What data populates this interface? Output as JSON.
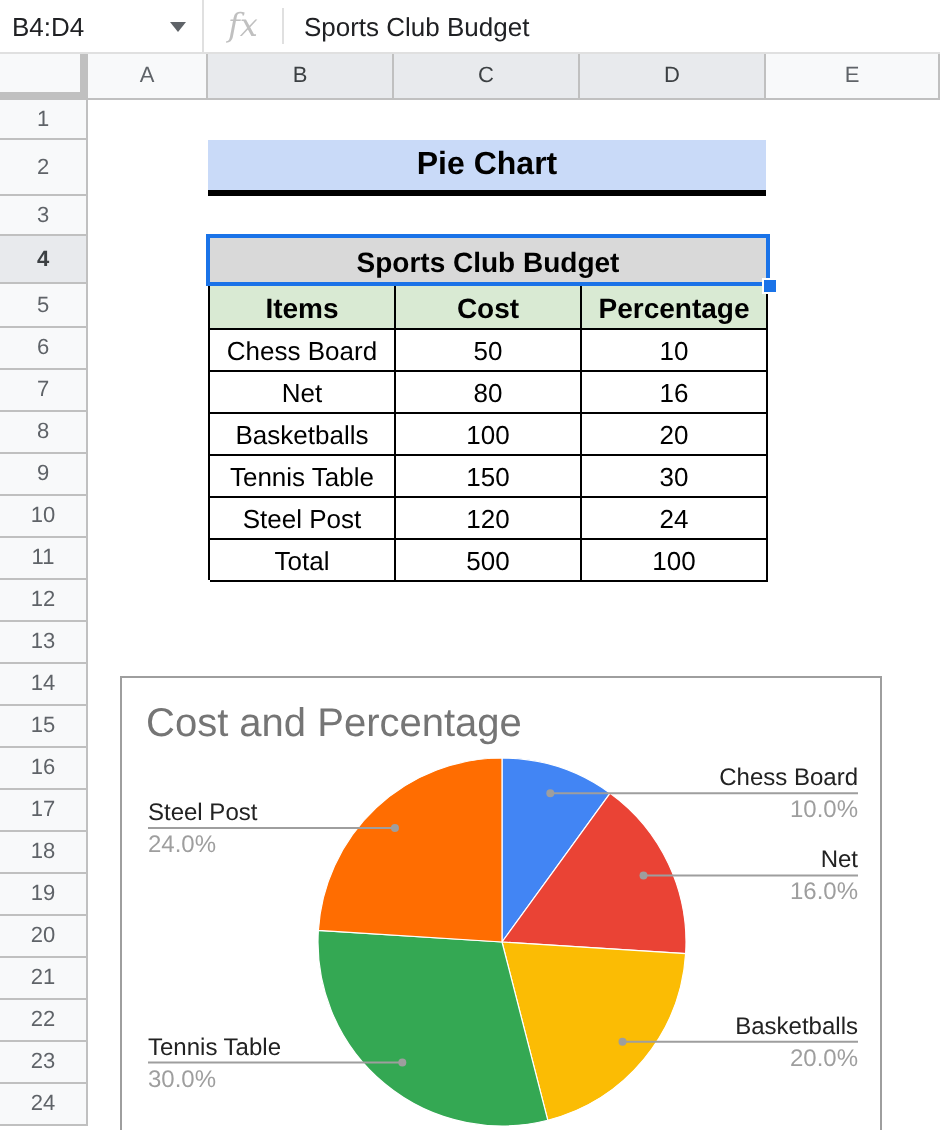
{
  "formula_bar": {
    "name_box": "B4:D4",
    "fx": "fx",
    "formula": "Sports Club Budget"
  },
  "columns": [
    {
      "label": "A",
      "selected": false
    },
    {
      "label": "B",
      "selected": true
    },
    {
      "label": "C",
      "selected": true
    },
    {
      "label": "D",
      "selected": true
    },
    {
      "label": "E",
      "selected": false
    }
  ],
  "rows": [
    {
      "label": "1",
      "selected": false
    },
    {
      "label": "2",
      "selected": false
    },
    {
      "label": "3",
      "selected": false
    },
    {
      "label": "4",
      "selected": true
    },
    {
      "label": "5",
      "selected": false
    },
    {
      "label": "6",
      "selected": false
    },
    {
      "label": "7",
      "selected": false
    },
    {
      "label": "8",
      "selected": false
    },
    {
      "label": "9",
      "selected": false
    },
    {
      "label": "10",
      "selected": false
    },
    {
      "label": "11",
      "selected": false
    },
    {
      "label": "12",
      "selected": false
    },
    {
      "label": "13",
      "selected": false
    },
    {
      "label": "14",
      "selected": false
    },
    {
      "label": "15",
      "selected": false
    },
    {
      "label": "16",
      "selected": false
    },
    {
      "label": "17",
      "selected": false
    },
    {
      "label": "18",
      "selected": false
    },
    {
      "label": "19",
      "selected": false
    },
    {
      "label": "20",
      "selected": false
    },
    {
      "label": "21",
      "selected": false
    },
    {
      "label": "22",
      "selected": false
    },
    {
      "label": "23",
      "selected": false
    },
    {
      "label": "24",
      "selected": false
    }
  ],
  "heading": "Pie Chart",
  "table": {
    "title": "Sports Club Budget",
    "columns": [
      "Items",
      "Cost",
      "Percentage"
    ],
    "rows": [
      [
        "Chess Board",
        "50",
        "10"
      ],
      [
        "Net",
        "80",
        "16"
      ],
      [
        "Basketballs",
        "100",
        "20"
      ],
      [
        "Tennis Table",
        "150",
        "30"
      ],
      [
        "Steel Post",
        "120",
        "24"
      ],
      [
        "Total",
        "500",
        "100"
      ]
    ]
  },
  "chart": {
    "chart_data": {
      "type": "pie",
      "title": "Cost and Percentage",
      "categories": [
        "Chess Board",
        "Net",
        "Basketballs",
        "Tennis Table",
        "Steel Post"
      ],
      "values": [
        10,
        16,
        20,
        30,
        24
      ],
      "value_labels": [
        "10.0%",
        "16.0%",
        "20.0%",
        "30.0%",
        "24.0%"
      ],
      "colors": [
        "#4285f4",
        "#ea4335",
        "#fbbc04",
        "#34a853",
        "#ff6d01"
      ]
    }
  }
}
